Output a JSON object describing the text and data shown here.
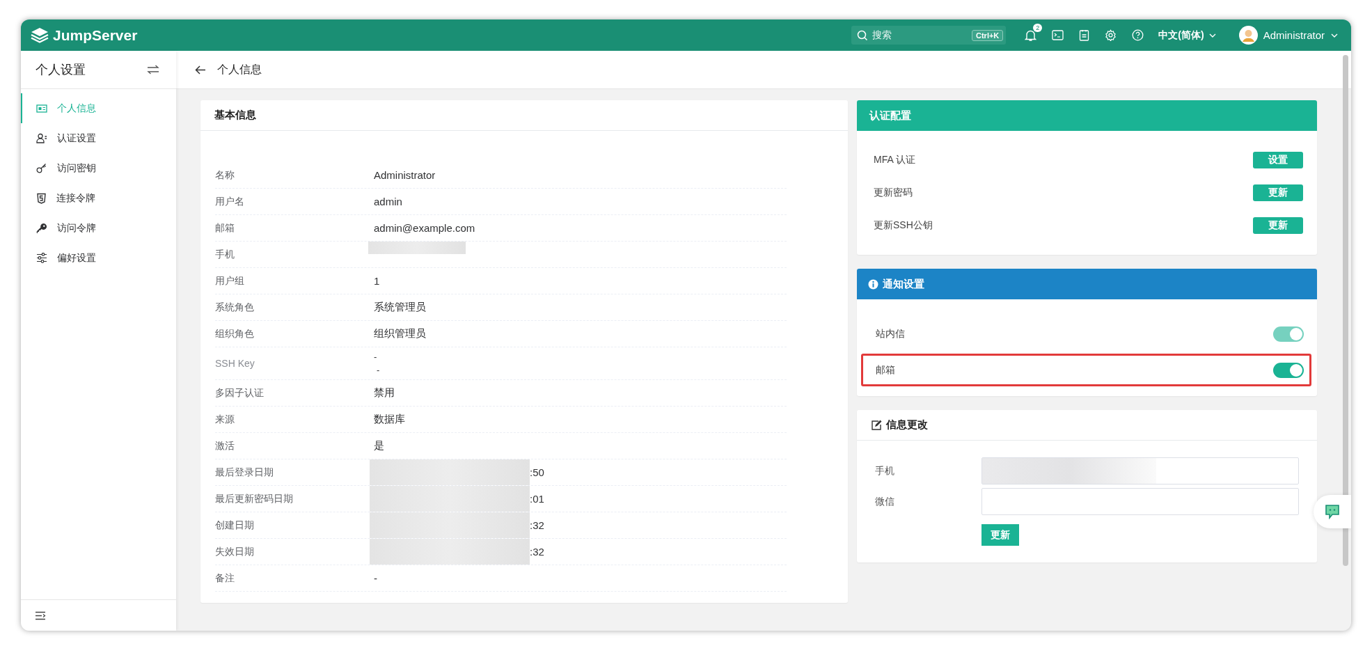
{
  "topbar": {
    "logo": "JumpServer",
    "search": {
      "placeholder": "搜索",
      "shortcut": "Ctrl+K"
    },
    "notifications": "2",
    "language": "中文(简体)",
    "user": "Administrator"
  },
  "sidebar": {
    "title": "个人设置",
    "items": [
      {
        "label": "个人信息",
        "selected": true
      },
      {
        "label": "认证设置",
        "selected": false
      },
      {
        "label": "访问密钥",
        "selected": false
      },
      {
        "label": "连接令牌",
        "selected": false
      },
      {
        "label": "访问令牌",
        "selected": false
      },
      {
        "label": "偏好设置",
        "selected": false
      }
    ]
  },
  "page": {
    "title": "个人信息"
  },
  "basic_info": {
    "title": "基本信息",
    "rows": [
      {
        "label": "名称",
        "value": "Administrator"
      },
      {
        "label": "用户名",
        "value": "admin"
      },
      {
        "label": "邮箱",
        "value": "admin@example.com"
      },
      {
        "label": "手机",
        "redacted": true
      },
      {
        "label": "用户组",
        "value": "1"
      },
      {
        "label": "系统角色",
        "value": "系统管理员"
      },
      {
        "label": "组织角色",
        "value": "组织管理员"
      },
      {
        "label": "SSH Key",
        "lines": [
          "-",
          "-"
        ]
      },
      {
        "label": "多因子认证",
        "value": "禁用"
      },
      {
        "label": "来源",
        "value": "数据库"
      },
      {
        "label": "激活",
        "value": "是"
      },
      {
        "label": "最后登录日期",
        "value": ":50",
        "redacted": true
      },
      {
        "label": "最后更新密码日期",
        "value": ":01",
        "redacted": true
      },
      {
        "label": "创建日期",
        "value": ":32",
        "redacted": true
      },
      {
        "label": "失效日期",
        "value": ":32",
        "redacted": true
      },
      {
        "label": "备注",
        "value": "-"
      }
    ]
  },
  "auth": {
    "title": "认证配置",
    "rows": [
      {
        "label": "MFA 认证",
        "button": "设置"
      },
      {
        "label": "更新密码",
        "button": "更新"
      },
      {
        "label": "更新SSH公钥",
        "button": "更新"
      }
    ]
  },
  "notify": {
    "title": "通知设置",
    "rows": [
      {
        "label": "站内信",
        "on": true,
        "disabled": true,
        "highlighted": false
      },
      {
        "label": "邮箱",
        "on": true,
        "disabled": false,
        "highlighted": true
      }
    ]
  },
  "edit": {
    "title": "信息更改",
    "fields": [
      {
        "label": "手机",
        "redacted": true
      },
      {
        "label": "微信",
        "redacted": false
      }
    ],
    "button": "更新"
  }
}
